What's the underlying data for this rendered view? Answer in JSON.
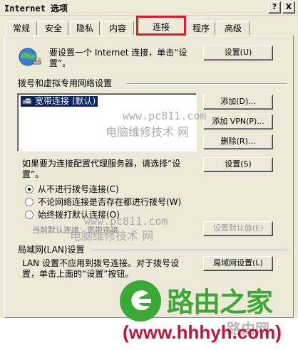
{
  "window": {
    "title": "Internet 选项",
    "help_btn": "?",
    "close_btn": "X"
  },
  "tabs": [
    "常规",
    "安全",
    "隐私",
    "内容",
    "连接",
    "程序",
    "高级"
  ],
  "setup": {
    "text_line1": "要设置一个 Internet 连接，单击“设",
    "text_line2": "置”。",
    "button": "设置(U)"
  },
  "dialup": {
    "title": "拨号和虚拟专用网络设置",
    "item": "宽带连接 (默认)",
    "add": "添加(D)...",
    "add_vpn": "添加 VPN(P)...",
    "delete": "删除(R)...",
    "proxy_line1": "如果要为连接配置代理服务器，请选择“设",
    "proxy_line2": "置”。",
    "settings": "设置(S)",
    "radio1": "从不进行拨号连接(C)",
    "radio2": "不论网络连接是否存在都进行拨号(W)",
    "radio3": "始终拨打默认连接(O)",
    "current_default": "当前默认连接：宽带连接",
    "set_default": "设置默认值(E)"
  },
  "lan": {
    "title": "局域网(LAN)设置",
    "line1": "LAN 设置不应用到拨号连接。对于拨号设",
    "line2": "置，单击上面的“设置”按钮。",
    "button": "局域网设置(L)"
  },
  "watermarks": {
    "url1": "www.pc811.com",
    "name1": "电脑维修技术 网",
    "url2": "www.pc811.com",
    "name2": "电脑维修技术 网"
  },
  "footer": {
    "brand": "路由之家",
    "url": "(www.hhhyh.com)",
    "faded": "路由网"
  },
  "colors": {
    "brand_green": "#3aa935",
    "brand_red": "#c0143c",
    "highlight": "#e11d1d"
  }
}
